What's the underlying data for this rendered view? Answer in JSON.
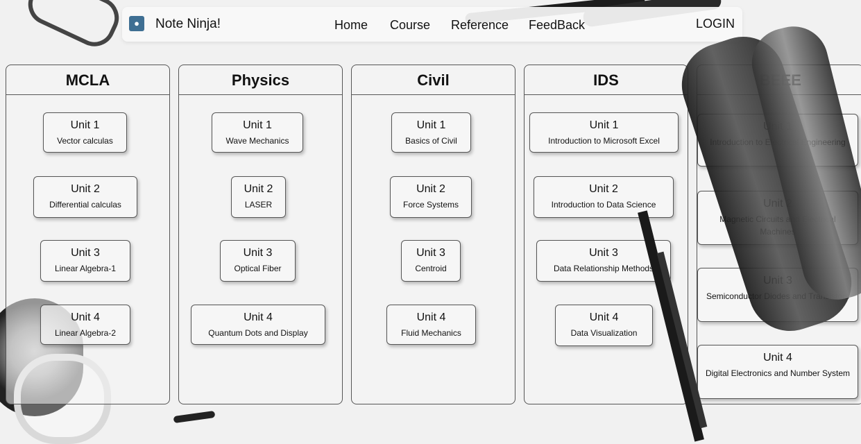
{
  "navbar": {
    "brand": "Note Ninja!",
    "logo_icon": "ninja-logo-icon",
    "links": [
      "Home",
      "Course",
      "Reference",
      "FeedBack"
    ],
    "login": "LOGIN"
  },
  "subjects": [
    {
      "title": "MCLA",
      "units": [
        {
          "title": "Unit 1",
          "desc": "Vector calculas"
        },
        {
          "title": "Unit 2",
          "desc": "Differential calculas"
        },
        {
          "title": "Unit 3",
          "desc": "Linear Algebra-1"
        },
        {
          "title": "Unit 4",
          "desc": "Linear Algebra-2"
        }
      ]
    },
    {
      "title": "Physics",
      "units": [
        {
          "title": "Unit 1",
          "desc": "Wave Mechanics"
        },
        {
          "title": "Unit 2",
          "desc": "LASER"
        },
        {
          "title": "Unit 3",
          "desc": "Optical Fiber"
        },
        {
          "title": "Unit 4",
          "desc": "Quantum Dots and Display"
        }
      ]
    },
    {
      "title": "Civil",
      "units": [
        {
          "title": "Unit 1",
          "desc": "Basics of Civil"
        },
        {
          "title": "Unit 2",
          "desc": "Force Systems"
        },
        {
          "title": "Unit 3",
          "desc": "Centroid"
        },
        {
          "title": "Unit 4",
          "desc": "Fluid Mechanics"
        }
      ]
    },
    {
      "title": "IDS",
      "units": [
        {
          "title": "Unit 1",
          "desc": "Introduction to Microsoft Excel"
        },
        {
          "title": "Unit 2",
          "desc": "Introduction to Data Science"
        },
        {
          "title": "Unit 3",
          "desc": "Data Relationship Methods"
        },
        {
          "title": "Unit 4",
          "desc": "Data Visualization"
        }
      ]
    },
    {
      "title": "BEEE",
      "units": [
        {
          "title": "Unit 1",
          "desc": "Introduction to Electrical Engineering"
        },
        {
          "title": "Unit 2",
          "desc": "Magnetic Circuits and Electrical Machines"
        },
        {
          "title": "Unit 3",
          "desc": "Semiconductor Diodes and Transistors"
        },
        {
          "title": "Unit 4",
          "desc": "Digital Electronics and Number System"
        }
      ]
    }
  ]
}
